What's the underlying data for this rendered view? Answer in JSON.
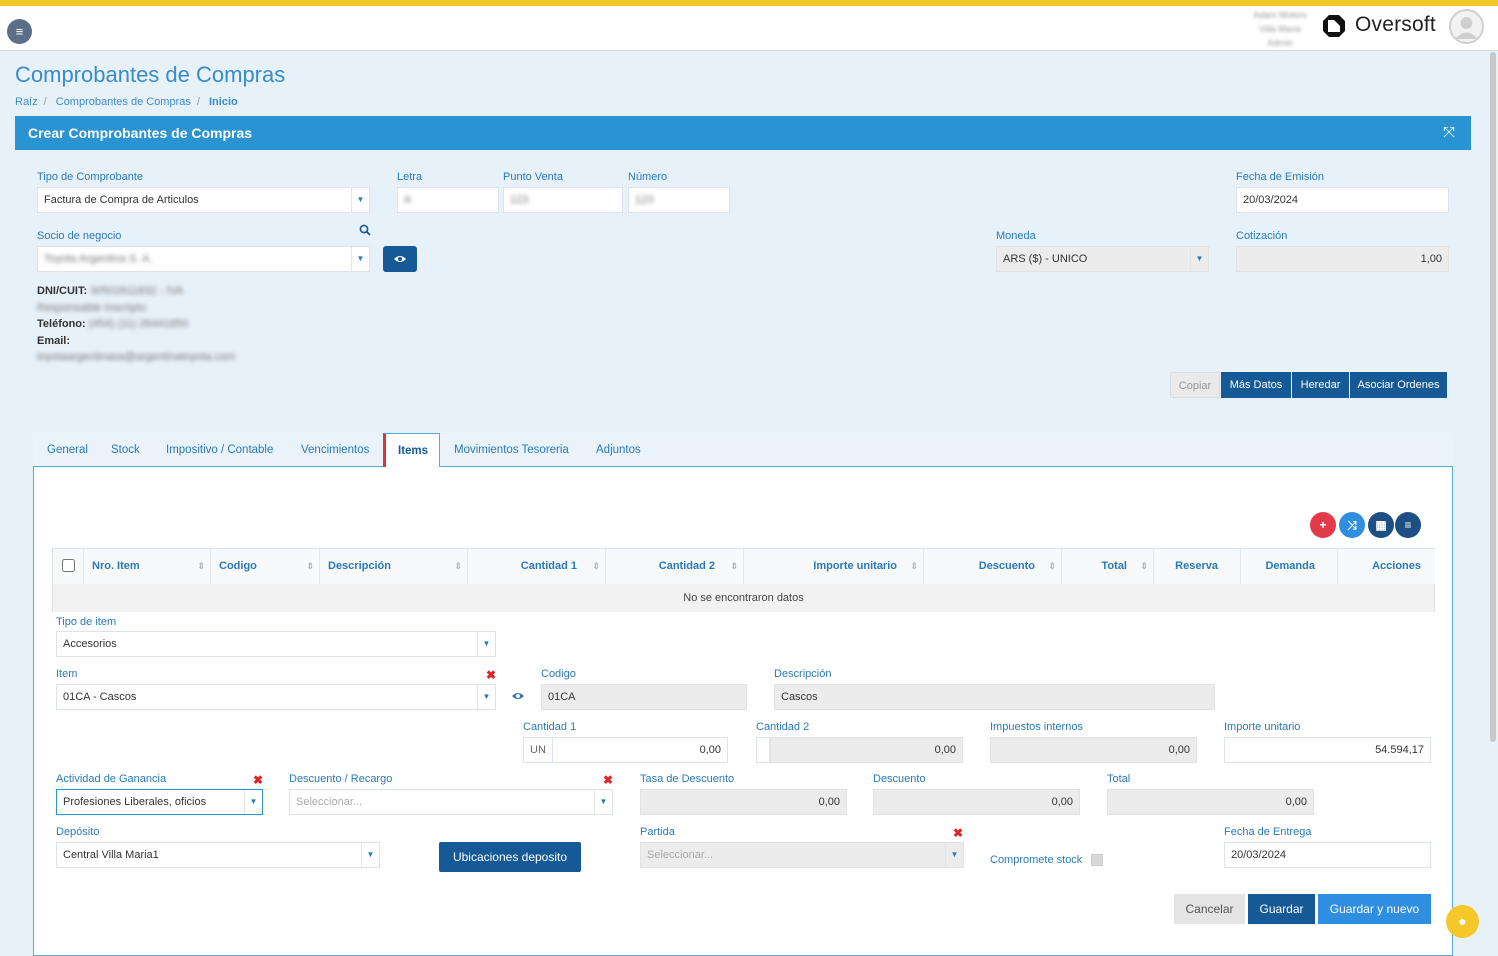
{
  "topbar": {
    "brand": "Oversoft",
    "user_name": "Adam Motors",
    "user_sub": "Villa Maria",
    "user_role": "Admin"
  },
  "page": {
    "title": "Comprobantes de Compras",
    "breadcrumb": [
      "Raíz",
      "Comprobantes de Compras",
      "Inicio"
    ]
  },
  "panel": {
    "title": "Crear Comprobantes de Compras"
  },
  "header_form": {
    "tipo_label": "Tipo de Comprobante",
    "tipo_value": "Factura de Compra de Articulos",
    "letra_label": "Letra",
    "letra_value": "A",
    "pv_label": "Punto Venta",
    "pv_value": "123",
    "numero_label": "Número",
    "numero_value": "123",
    "fecha_label": "Fecha de Emisión",
    "fecha_value": "20/03/2024",
    "socio_label": "Socio de negocio",
    "socio_value": "Toyota Argentina S. A.",
    "moneda_label": "Moneda",
    "moneda_value": "ARS ($) - UNICO",
    "cotizacion_label": "Cotización",
    "cotizacion_value": "1,00",
    "dni_label": "DNI/CUIT:",
    "dni_value": "30502611832 - IVA",
    "iva_value": "Responsable Inscripto",
    "tel_label": "Teléfono:",
    "tel_value": "(454) (11) 26441850",
    "email_label": "Email:",
    "email_value": "toyotaargentinasa@argentinatoyota.com"
  },
  "actions": {
    "copiar": "Copiar",
    "mas_datos": "Más Datos",
    "heredar": "Heredar",
    "asociar": "Asociar Ordenes"
  },
  "tabs": [
    "General",
    "Stock",
    "Impositivo / Contable",
    "Vencimientos",
    "Items",
    "Movimientos Tesoreria",
    "Adjuntos"
  ],
  "grid": {
    "columns": [
      "Nro. Item",
      "Codigo",
      "Descripción",
      "Cantidad 1",
      "Cantidad 2",
      "Importe unitario",
      "Descuento",
      "Total",
      "Reserva",
      "Demanda",
      "Acciones"
    ],
    "empty": "No se encontraron datos"
  },
  "item_form": {
    "tipo_item_label": "Tipo de item",
    "tipo_item_value": "Accesorios",
    "item_label": "Item",
    "item_value": "01CA - Cascos",
    "codigo_label": "Codigo",
    "codigo_value": "01CA",
    "desc_label": "Descripción",
    "desc_value": "Cascos",
    "cant1_label": "Cantidad 1",
    "cant1_unit": "UN",
    "cant1_value": "0,00",
    "cant2_label": "Cantidad 2",
    "cant2_value": "0,00",
    "imp_int_label": "Impuestos internos",
    "imp_int_value": "0,00",
    "imp_unit_label": "Importe unitario",
    "imp_unit_value": "54.594,17",
    "actividad_label": "Actividad de Ganancia",
    "actividad_value": "Profesiones Liberales, oficios",
    "desc_rec_label": "Descuento / Recargo",
    "desc_rec_placeholder": "Seleccionar...",
    "tasa_label": "Tasa de Descuento",
    "tasa_value": "0,00",
    "descuento_label": "Descuento",
    "descuento_value": "0,00",
    "total_label": "Total",
    "total_value": "0,00",
    "deposito_label": "Depósito",
    "deposito_value": "Central Villa Maria1",
    "ubicaciones_btn": "Ubicaciones deposito",
    "partida_label": "Partida",
    "partida_placeholder": "Seleccionar...",
    "compromete_label": "Compromete stock",
    "fecha_entrega_label": "Fecha de Entrega",
    "fecha_entrega_value": "20/03/2024"
  },
  "footer": {
    "cancelar": "Cancelar",
    "guardar": "Guardar",
    "guardar_nuevo": "Guardar y nuevo"
  },
  "colors": {
    "accent": "#2a93d1",
    "primary": "#155a96",
    "stripe": "#f6c728",
    "danger": "#e0242b"
  }
}
